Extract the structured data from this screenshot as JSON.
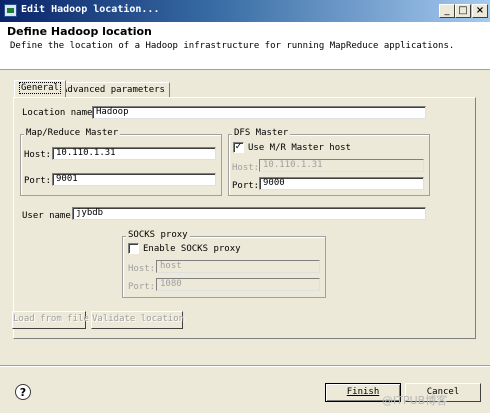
{
  "window": {
    "title": "Edit Hadoop location...",
    "controls": {
      "minimize": "_",
      "maximize": "□",
      "close": "×"
    }
  },
  "header": {
    "title": "Define Hadoop location",
    "description": "Define the location of a Hadoop infrastructure for running MapReduce applications."
  },
  "tabs": [
    {
      "label": "General",
      "selected": true
    },
    {
      "label": "Advanced parameters",
      "selected": false
    }
  ],
  "general": {
    "location_name_label": "Location name:",
    "location_name_value": "Hadoop",
    "mr_master": {
      "title": "Map/Reduce Master",
      "host_label": "Host:",
      "host_value": "10.110.1.31",
      "port_label": "Port:",
      "port_value": "9001"
    },
    "dfs_master": {
      "title": "DFS Master",
      "use_mr_host_label": "Use M/R Master host",
      "use_mr_host_checked": true,
      "host_label": "Host:",
      "host_value": "10.110.1.31",
      "port_label": "Port:",
      "port_value": "9000"
    },
    "user_name_label": "User name:",
    "user_name_value": "jybdb",
    "socks": {
      "title": "SOCKS proxy",
      "enable_label": "Enable SOCKS proxy",
      "enable_checked": false,
      "host_label": "Host:",
      "host_value": "host",
      "port_label": "Port:",
      "port_value": "1080"
    },
    "load_button": "Load from file",
    "validate_button": "Validate location"
  },
  "footer": {
    "help_glyph": "?",
    "finish_button": "Finish",
    "cancel_button": "Cancel",
    "watermark": "@ITPUB博客"
  }
}
